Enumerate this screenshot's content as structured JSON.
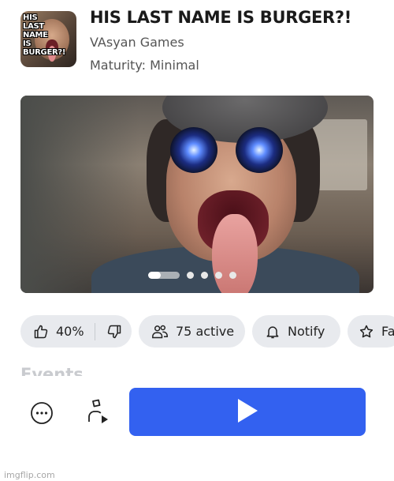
{
  "game": {
    "thumbnail_caption": "HIS\nLAST\nNAME\nIS\nBURGER?!",
    "title": "HIS LAST NAME IS BURGER?!",
    "creator": "VAsyan Games",
    "maturity": "Maturity: Minimal"
  },
  "carousel": {
    "slide_count": 5,
    "active_index": 0
  },
  "actions": {
    "vote_percent": "40%",
    "active_count": "75 active",
    "notify_label": "Notify",
    "favorite_label_partial": "Fa"
  },
  "sections": {
    "events_heading": "Events"
  },
  "bottom_bar": {
    "more_icon": "more-dots-icon",
    "avatar_icon": "avatar-play-icon",
    "play_icon": "play-icon",
    "play_color": "#3361f0"
  },
  "watermark": "imgflip.com",
  "colors": {
    "pill_bg": "#e8eaee",
    "primary": "#3361f0"
  }
}
